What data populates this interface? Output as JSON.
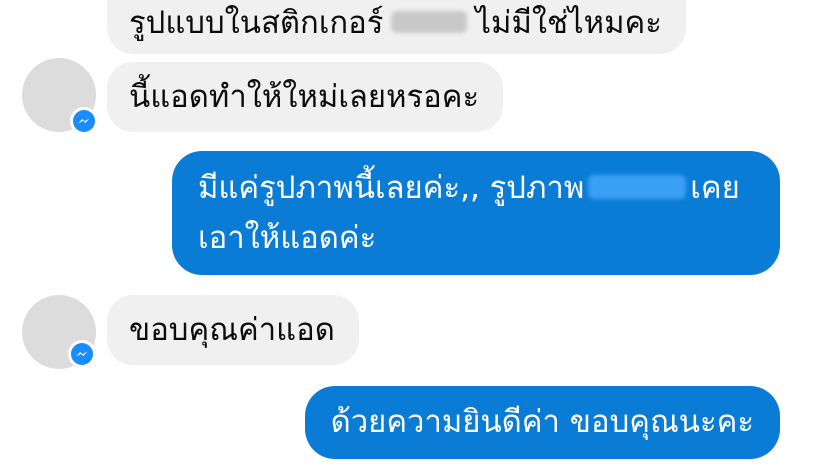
{
  "messages": [
    {
      "direction": "incoming",
      "text_before": "รูปแบบในสติกเกอร์",
      "redaction": "blurred-name",
      "text_after": "ไม่มีใช่ไหมคะ"
    },
    {
      "direction": "incoming",
      "text": "นี้แอดทำให้ใหม่เลยหรอคะ"
    },
    {
      "direction": "outgoing",
      "line1_before": "มีแค่รูปภาพนี้เลยค่ะ,, รูปภาพ",
      "redaction": "blurred-name",
      "line1_after": "เคย",
      "line2": "เอาให้แอดค่ะ"
    },
    {
      "direction": "incoming",
      "text": "ขอบคุณค่าแอด"
    },
    {
      "direction": "outgoing",
      "text": "ด้วยความยินดีค่า ขอบคุณนะคะ"
    }
  ],
  "icons": {
    "avatar": "blurred-avatar",
    "badge": "messenger-icon"
  },
  "colors": {
    "incoming_bubble": "#f1f0f0",
    "outgoing_bubble": "#0a7cd6",
    "messenger_badge": "#1a8cff",
    "redaction_light": "#c8c8c8",
    "redaction_blue": "#3aa0f5"
  }
}
